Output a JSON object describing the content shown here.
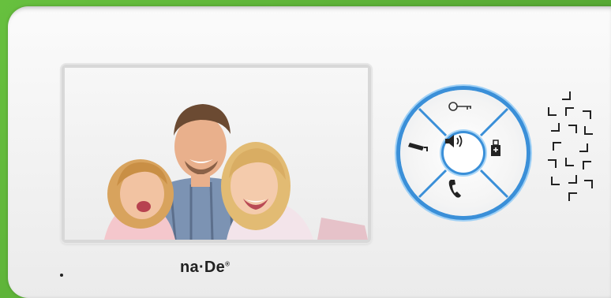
{
  "device": {
    "brand_name": "na·De",
    "brand_mark": "®",
    "body_color": "#f4f4f4",
    "background_color": "#5fb43a",
    "accent_color": "#3a8fd8"
  },
  "screen": {
    "content": "photo"
  },
  "keypad": {
    "buttons": [
      {
        "name": "unlock-button",
        "icon": "key-icon"
      },
      {
        "name": "monitor-button",
        "icon": "camera-icon"
      },
      {
        "name": "volume-button",
        "icon": "speaker-icon"
      },
      {
        "name": "intercom-button",
        "icon": "handset-icon"
      },
      {
        "name": "talk-button",
        "icon": "phone-icon"
      }
    ]
  }
}
